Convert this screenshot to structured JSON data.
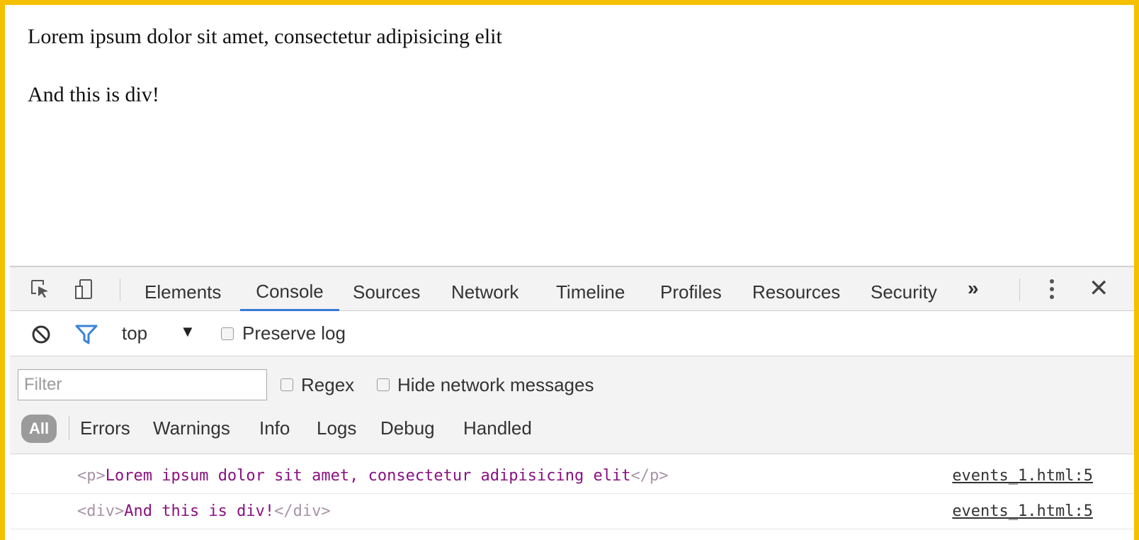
{
  "page": {
    "paragraph_text": "Lorem ipsum dolor sit amet, consectetur adipisicing elit",
    "div_text": "And this is div!"
  },
  "devtools": {
    "icons": {
      "inspect": "inspect-element-icon",
      "device": "device-mode-icon",
      "more_tabs": "»",
      "menu": "kebab-menu-icon",
      "close": "✕"
    },
    "tabs": [
      {
        "label": "Elements",
        "active": false
      },
      {
        "label": "Console",
        "active": true
      },
      {
        "label": "Sources",
        "active": false
      },
      {
        "label": "Network",
        "active": false
      },
      {
        "label": "Timeline",
        "active": false
      },
      {
        "label": "Profiles",
        "active": false
      },
      {
        "label": "Resources",
        "active": false
      },
      {
        "label": "Security",
        "active": false
      }
    ],
    "toolbar": {
      "context": "top",
      "caret": "▼",
      "preserve_log_label": "Preserve log"
    },
    "filters": {
      "placeholder": "Filter",
      "regex_label": "Regex",
      "hide_network_label": "Hide network messages",
      "levels": [
        "All",
        "Errors",
        "Warnings",
        "Info",
        "Logs",
        "Debug",
        "Handled"
      ]
    },
    "logs": [
      {
        "open": "<p>",
        "text": "Lorem ipsum dolor sit amet, consectetur adipisicing elit",
        "close": "</p>",
        "source": "events_1.html:5"
      },
      {
        "open": "<div>",
        "text": "And this is div!",
        "close": "</div>",
        "source": "events_1.html:5"
      }
    ],
    "colors": {
      "frame": "#f5c000",
      "active_tab": "#3879d9",
      "filter_icon": "#3b82d6",
      "log_tag": "#881280"
    }
  }
}
